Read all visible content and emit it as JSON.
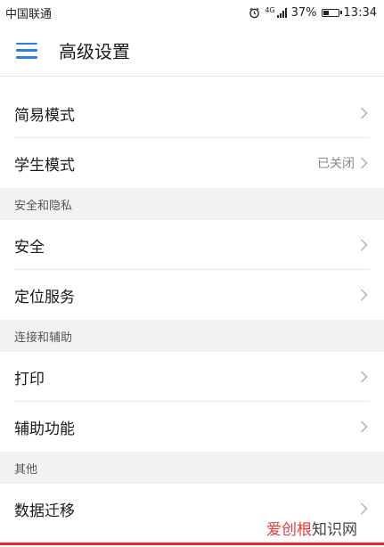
{
  "status_bar": {
    "carrier": "中国联通",
    "network": "4G",
    "battery": "37%",
    "time": "13:34"
  },
  "header": {
    "title": "高级设置",
    "menu_icon": "hamburger-menu-icon",
    "accent_color": "#2b7de9"
  },
  "sections": [
    {
      "header": "",
      "items": [
        {
          "label": "简易模式",
          "value": ""
        },
        {
          "label": "学生模式",
          "value": "已关闭"
        }
      ]
    },
    {
      "header": "安全和隐私",
      "items": [
        {
          "label": "安全",
          "value": ""
        },
        {
          "label": "定位服务",
          "value": ""
        }
      ]
    },
    {
      "header": "连接和辅助",
      "items": [
        {
          "label": "打印",
          "value": ""
        },
        {
          "label": "辅助功能",
          "value": ""
        }
      ]
    },
    {
      "header": "其他",
      "items": [
        {
          "label": "数据迁移",
          "value": ""
        }
      ]
    }
  ],
  "watermark": {
    "highlight": "爱创根",
    "rest": "知识网"
  },
  "highlight_color": "#e8272b"
}
